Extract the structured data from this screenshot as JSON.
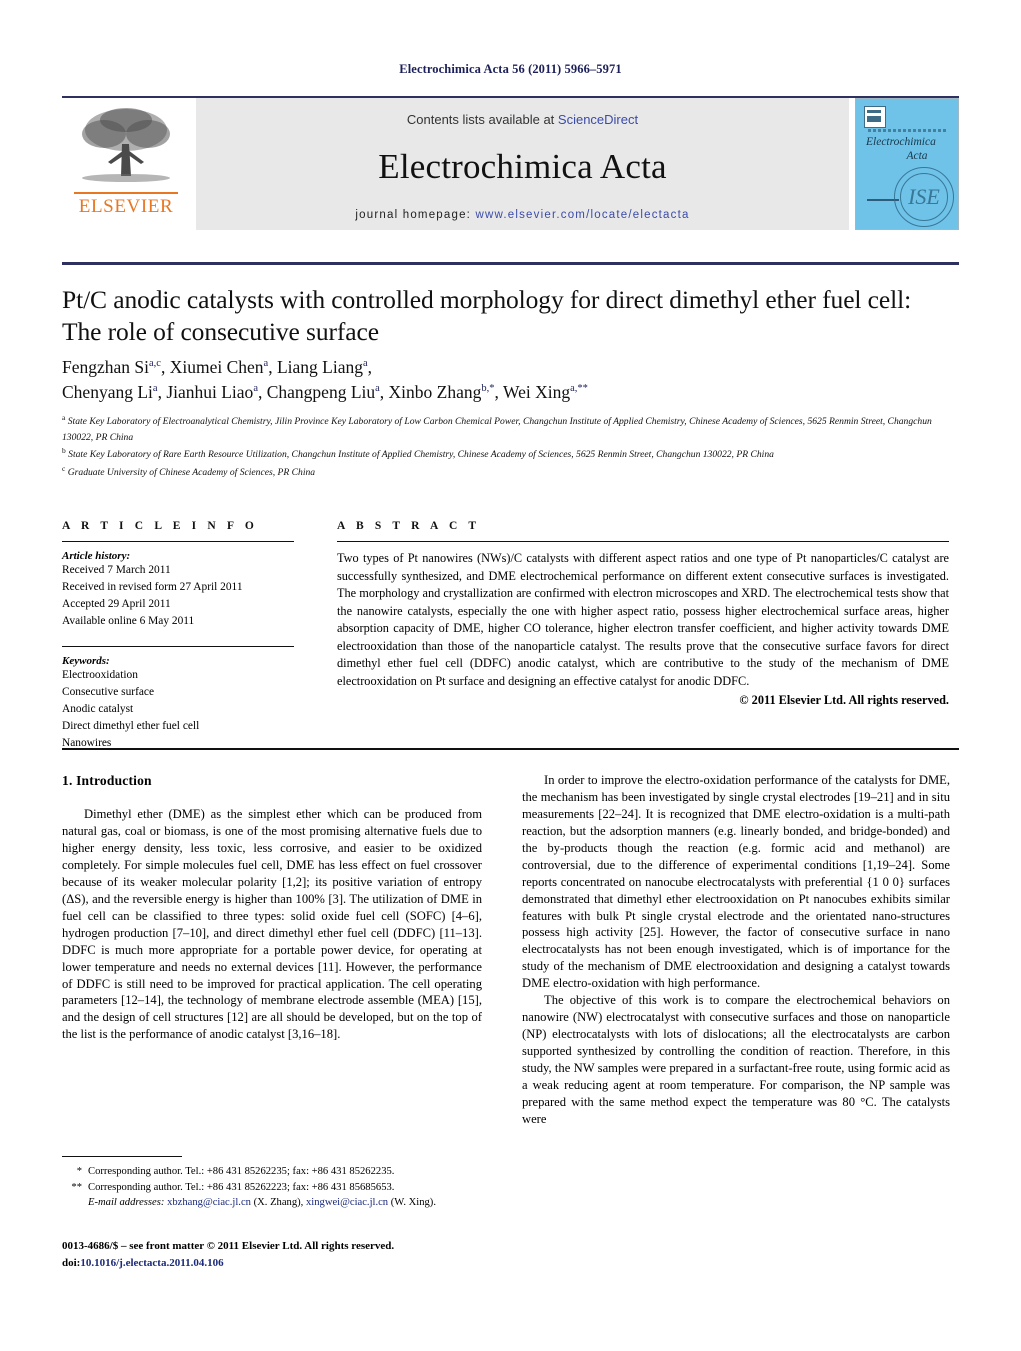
{
  "running_head": "Electrochimica Acta 56 (2011) 5966–5971",
  "masthead": {
    "contents_prefix": "Contents lists available at ",
    "sciencedirect": "ScienceDirect",
    "journal_title": "Electrochimica Acta",
    "homepage_label": "journal homepage:",
    "homepage_url": "www.elsevier.com/locate/electacta",
    "publisher": "ELSEVIER",
    "cover": {
      "title_line1": "Electrochimica",
      "title_line2": "Acta",
      "society": "ISE"
    }
  },
  "article": {
    "title": "Pt/C anodic catalysts with controlled morphology for direct dimethyl ether fuel cell: The role of consecutive surface",
    "authors_line1": "Fengzhan Si",
    "authors": [
      {
        "name": "Fengzhan Si",
        "sup": "a,c"
      },
      {
        "name": "Xiumei Chen",
        "sup": "a"
      },
      {
        "name": "Liang Liang",
        "sup": "a"
      },
      {
        "name": "Chenyang Li",
        "sup": "a"
      },
      {
        "name": "Jianhui Liao",
        "sup": "a"
      },
      {
        "name": "Changpeng Liu",
        "sup": "a"
      },
      {
        "name": "Xinbo Zhang",
        "sup": "b,*"
      },
      {
        "name": "Wei Xing",
        "sup": "a,**"
      }
    ],
    "affiliations": [
      {
        "mark": "a",
        "text": "State Key Laboratory of Electroanalytical Chemistry, Jilin Province Key Laboratory of Low Carbon Chemical Power, Changchun Institute of Applied Chemistry, Chinese Academy of Sciences, 5625 Renmin Street, Changchun 130022, PR China"
      },
      {
        "mark": "b",
        "text": "State Key Laboratory of Rare Earth Resource Utilization, Changchun Institute of Applied Chemistry, Chinese Academy of Sciences, 5625 Renmin Street, Changchun 130022, PR China"
      },
      {
        "mark": "c",
        "text": "Graduate University of Chinese Academy of Sciences, PR China"
      }
    ]
  },
  "article_info": {
    "heading": "A R T I C L E  I N F O",
    "history_label": "Article history:",
    "history": [
      "Received 7 March 2011",
      "Received in revised form 27 April 2011",
      "Accepted 29 April 2011",
      "Available online 6 May 2011"
    ],
    "keywords_label": "Keywords:",
    "keywords": [
      "Electrooxidation",
      "Consecutive surface",
      "Anodic catalyst",
      "Direct dimethyl ether fuel cell",
      "Nanowires"
    ]
  },
  "abstract": {
    "heading": "A B S T R A C T",
    "text": "Two types of Pt nanowires (NWs)/C catalysts with different aspect ratios and one type of Pt nanoparticles/C catalyst are successfully synthesized, and DME electrochemical performance on different extent consecutive surfaces is investigated. The morphology and crystallization are confirmed with electron microscopes and XRD. The electrochemical tests show that the nanowire catalysts, especially the one with higher aspect ratio, possess higher electrochemical surface areas, higher absorption capacity of DME, higher CO tolerance, higher electron transfer coefficient, and higher activity towards DME electrooxidation than those of the nanoparticle catalyst. The results prove that the consecutive surface favors for direct dimethyl ether fuel cell (DDFC) anodic catalyst, which are contributive to the study of the mechanism of DME electrooxidation on Pt surface and designing an effective catalyst for anodic DDFC.",
    "copyright": "© 2011 Elsevier Ltd. All rights reserved."
  },
  "body": {
    "section_number_title": "1.  Introduction",
    "left_paragraphs": [
      "Dimethyl ether (DME) as the simplest ether which can be produced from natural gas, coal or biomass, is one of the most promising alternative fuels due to higher energy density, less toxic, less corrosive, and easier to be oxidized completely. For simple molecules fuel cell, DME has less effect on fuel crossover because of its weaker molecular polarity [1,2]; its positive variation of entropy (ΔS), and the reversible energy is higher than 100% [3]. The utilization of DME in fuel cell can be classified to three types: solid oxide fuel cell (SOFC) [4–6], hydrogen production [7–10], and direct dimethyl ether fuel cell (DDFC) [11–13]. DDFC is much more appropriate for a portable power device, for operating at lower temperature and needs no external devices [11]. However, the performance of DDFC is still need to be improved for practical application. The cell operating parameters [12–14], the technology of membrane electrode assemble (MEA) [15], and the design of cell structures [12] are all should be developed, but on the top of the list is the performance of anodic catalyst [3,16–18]."
    ],
    "right_paragraphs": [
      "In order to improve the electro-oxidation performance of the catalysts for DME, the mechanism has been investigated by single crystal electrodes [19–21] and in situ measurements [22–24]. It is recognized that DME electro-oxidation is a multi-path reaction, but the adsorption manners (e.g. linearly bonded, and bridge-bonded) and the by-products though the reaction (e.g. formic acid and methanol) are controversial, due to the difference of experimental conditions [1,19–24]. Some reports concentrated on nanocube electrocatalysts with preferential {1 0 0} surfaces demonstrated that dimethyl ether electrooxidation on Pt nanocubes exhibits similar features with bulk Pt single crystal electrode and the orientated nano-structures possess high activity [25]. However, the factor of consecutive surface in nano electrocatalysts has not been enough investigated, which is of importance for the study of the mechanism of DME electrooxidation and designing a catalyst towards DME electro-oxidation with high performance.",
      "The objective of this work is to compare the electrochemical behaviors on nanowire (NW) electrocatalyst with consecutive surfaces and those on nanoparticle (NP) electrocatalysts with lots of dislocations; all the electrocatalysts are carbon supported synthesized by controlling the condition of reaction. Therefore, in this study, the NW samples were prepared in a surfactant-free route, using formic acid as a weak reducing agent at room temperature. For comparison, the NP sample was prepared with the same method expect the temperature was 80 °C. The catalysts were"
    ]
  },
  "footnotes": {
    "corresponding_1_mark": "*",
    "corresponding_1": "Corresponding author. Tel.: +86 431 85262235; fax: +86 431 85262235.",
    "corresponding_2_mark": "**",
    "corresponding_2": "Corresponding author. Tel.: +86 431 85262223; fax: +86 431 85685653.",
    "email_label": "E-mail addresses:",
    "email_1": "xbzhang@ciac.jl.cn",
    "email_1_owner": "(X. Zhang),",
    "email_2": "xingwei@ciac.jl.cn",
    "email_2_owner": "(W. Xing)."
  },
  "imprint": {
    "line1": "0013-4686/$ – see front matter © 2011 Elsevier Ltd. All rights reserved.",
    "doi_label": "doi:",
    "doi": "10.1016/j.electacta.2011.04.106"
  }
}
